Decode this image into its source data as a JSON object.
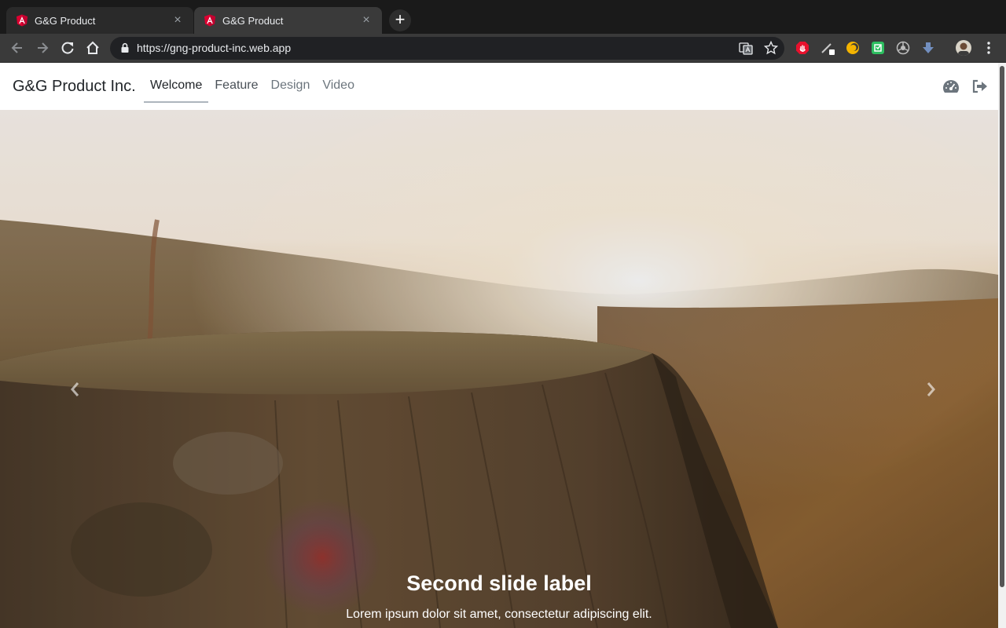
{
  "browser": {
    "tabs": [
      {
        "title": "G&G Product",
        "icon": "angular-icon",
        "active": false
      },
      {
        "title": "G&G Product",
        "icon": "angular-icon",
        "active": true
      }
    ],
    "address_bar": {
      "url": "https://gng-product-inc.web.app"
    },
    "accent_color": "#dd0031"
  },
  "site": {
    "brand": "G&G Product Inc.",
    "nav": [
      {
        "label": "Welcome",
        "active": true
      },
      {
        "label": "Feature",
        "active": false
      },
      {
        "label": "Design",
        "active": false
      },
      {
        "label": "Video",
        "active": false
      }
    ],
    "right_icons": [
      "dashboard-icon",
      "sign-out-icon"
    ]
  },
  "carousel": {
    "caption_title": "Second slide label",
    "caption_text": "Lorem ipsum dolor sit amet, consectetur adipiscing elit.",
    "controls": [
      "prev-icon",
      "next-icon"
    ]
  }
}
